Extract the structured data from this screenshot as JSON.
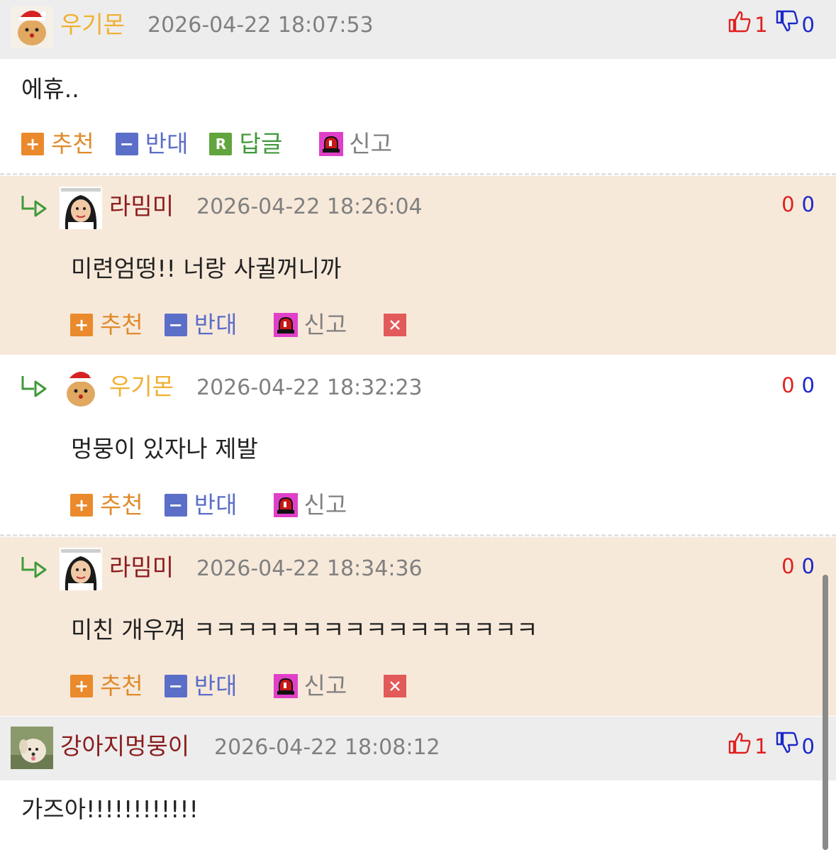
{
  "comments": [
    {
      "nickname": "우기몬",
      "date": "2026-04-22 18:07:53",
      "up": "1",
      "down": "0",
      "text": "에휴..",
      "actions": {
        "recommend": "추천",
        "oppose": "반대",
        "reply": "답글",
        "report": "신고"
      }
    },
    {
      "nickname": "라밈미",
      "date": "2026-04-22 18:26:04",
      "up": "0",
      "down": "0",
      "text": "미련엄떵!! 너랑 사귈꺼니까",
      "actions": {
        "recommend": "추천",
        "oppose": "반대",
        "report": "신고"
      }
    },
    {
      "nickname": "우기몬",
      "date": "2026-04-22 18:32:23",
      "up": "0",
      "down": "0",
      "text": "멍뭉이 있자나 제발",
      "actions": {
        "recommend": "추천",
        "oppose": "반대",
        "report": "신고"
      }
    },
    {
      "nickname": "라밈미",
      "date": "2026-04-22 18:34:36",
      "up": "0",
      "down": "0",
      "text": "미친 개우껴 ㅋㅋㅋㅋㅋㅋㅋㅋㅋㅋㅋㅋㅋㅋㅋㅋ",
      "actions": {
        "recommend": "추천",
        "oppose": "반대",
        "report": "신고"
      }
    },
    {
      "nickname": "강아지멍뭉이",
      "date": "2026-04-22 18:08:12",
      "up": "1",
      "down": "0",
      "text": "가즈아!!!!!!!!!!!!"
    }
  ],
  "colors": {
    "header_bg": "#ededed",
    "reply_bg": "#f7e9da",
    "nick_orange": "#f1b032",
    "nick_maroon": "#8a1c1c",
    "up_red": "#e02020",
    "down_blue": "#1a28c8"
  },
  "icons": [
    "thumbs-up-icon",
    "thumbs-down-icon",
    "plus-icon",
    "minus-icon",
    "reply-r-icon",
    "siren-report-icon",
    "delete-x-icon",
    "reply-arrow-icon"
  ]
}
